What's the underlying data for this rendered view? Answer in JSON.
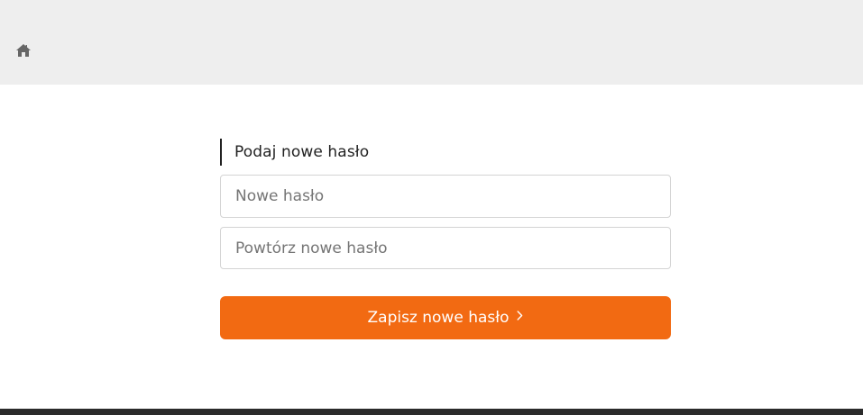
{
  "colors": {
    "top_bar": "#eeeeee",
    "accent": "#f26a12",
    "footer": "#2b2b2b",
    "home_icon": "#666666"
  },
  "header": {
    "home_icon": "home-icon"
  },
  "form": {
    "heading": "Podaj nowe hasło",
    "new_password": {
      "placeholder": "Nowe hasło",
      "value": ""
    },
    "repeat_password": {
      "placeholder": "Powtórz nowe hasło",
      "value": ""
    },
    "submit_label": "Zapisz nowe hasło",
    "submit_icon": "chevron-right-icon"
  }
}
